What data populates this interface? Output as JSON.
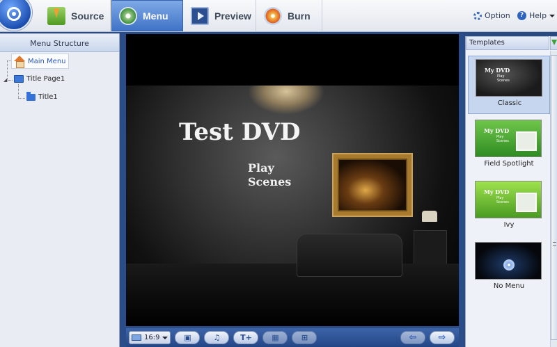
{
  "toolbar": {
    "tabs": [
      {
        "label": "Source",
        "icon": "download-arrow-icon"
      },
      {
        "label": "Menu",
        "icon": "menu-disc-icon",
        "active": true
      },
      {
        "label": "Preview",
        "icon": "preview-screen-icon"
      },
      {
        "label": "Burn",
        "icon": "burn-disc-icon"
      }
    ],
    "option_label": "Option",
    "help_label": "Help"
  },
  "menu_structure": {
    "title": "Menu Structure",
    "nodes": [
      {
        "label": "Main Menu",
        "icon": "home-icon",
        "selected": true
      },
      {
        "label": "Title Page1",
        "icon": "monitor-icon"
      },
      {
        "label": "Title1",
        "icon": "folder-icon"
      }
    ]
  },
  "preview": {
    "title": "Test DVD",
    "button_line1": "Play",
    "button_line2": "Scenes",
    "aspect_ratio": "16:9",
    "controls": [
      "background-image-icon",
      "music-note-icon",
      "text-add-icon",
      "layout-grid-icon",
      "chapter-grid-icon"
    ],
    "nav": [
      "prev-arrow-icon",
      "next-arrow-icon"
    ]
  },
  "templates": {
    "title": "Templates",
    "items": [
      {
        "name": "Classic",
        "thumb_title": "My DVD",
        "thumb_play": "Play",
        "thumb_scenes": "Scenes",
        "selected": true
      },
      {
        "name": "Field Spotlight",
        "thumb_title": "My DVD",
        "thumb_play": "Play",
        "thumb_scenes": "Scenes"
      },
      {
        "name": "Ivy",
        "thumb_title": "My DVD",
        "thumb_play": "Play",
        "thumb_scenes": "Scenes"
      },
      {
        "name": "No Menu"
      }
    ]
  }
}
